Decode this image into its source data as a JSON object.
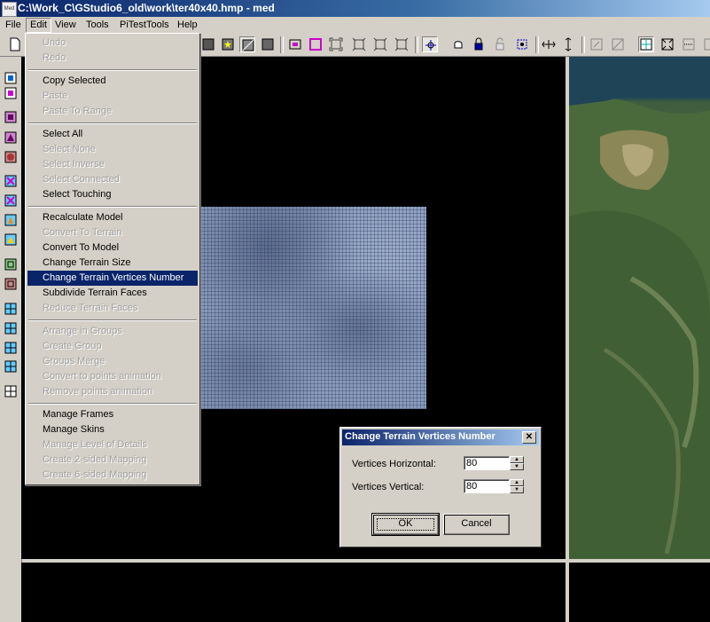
{
  "window": {
    "title": "C:\\Work_C\\GStudio6_old\\work\\ter40x40.hmp - med",
    "icon_label": "Med"
  },
  "menubar": {
    "items": [
      "File",
      "Edit",
      "View",
      "Tools",
      "PiTestTools",
      "Help"
    ]
  },
  "edit_menu": {
    "groups": [
      [
        {
          "label": "Undo",
          "enabled": false
        },
        {
          "label": "Redo",
          "enabled": false
        }
      ],
      [
        {
          "label": "Copy Selected",
          "enabled": true
        },
        {
          "label": "Paste",
          "enabled": false
        },
        {
          "label": "Paste To Range",
          "enabled": false
        }
      ],
      [
        {
          "label": "Select All",
          "enabled": true
        },
        {
          "label": "Select None",
          "enabled": false
        },
        {
          "label": "Select Inverse",
          "enabled": false
        },
        {
          "label": "Select Connected",
          "enabled": false
        },
        {
          "label": "Select Touching",
          "enabled": true
        }
      ],
      [
        {
          "label": "Recalculate Model",
          "enabled": true
        },
        {
          "label": "Convert To Terrain",
          "enabled": false
        },
        {
          "label": "Convert To Model",
          "enabled": true
        },
        {
          "label": "Change Terrain Size",
          "enabled": true
        },
        {
          "label": "Change Terrain Vertices Number",
          "enabled": true,
          "highlighted": true
        },
        {
          "label": "Subdivide Terrain Faces",
          "enabled": true
        },
        {
          "label": "Reduce Terrain Faces",
          "enabled": false
        }
      ],
      [
        {
          "label": "Arrange in Groups",
          "enabled": false
        },
        {
          "label": "Create Group",
          "enabled": false
        },
        {
          "label": "Groups Merge",
          "enabled": false
        },
        {
          "label": "Convert to points animation",
          "enabled": false
        },
        {
          "label": "Remove points animation",
          "enabled": false
        }
      ],
      [
        {
          "label": "Manage Frames",
          "enabled": true
        },
        {
          "label": "Manage Skins",
          "enabled": true
        },
        {
          "label": "Manage Level of Details",
          "enabled": false
        },
        {
          "label": "Create 2-sided Mapping",
          "enabled": false
        },
        {
          "label": "Create 6-sided Mapping",
          "enabled": false
        }
      ]
    ]
  },
  "dialog": {
    "title": "Change Terrain Vertices Number",
    "close_glyph": "✕",
    "fields": [
      {
        "label": "Vertices Horizontal:",
        "value": "80"
      },
      {
        "label": "Vertices Vertical:",
        "value": "80"
      }
    ],
    "ok_label": "OK",
    "cancel_label": "Cancel"
  },
  "colors": {
    "highlight": "#0a246a",
    "face": "#d4d0c8",
    "viewport": "#000000"
  }
}
